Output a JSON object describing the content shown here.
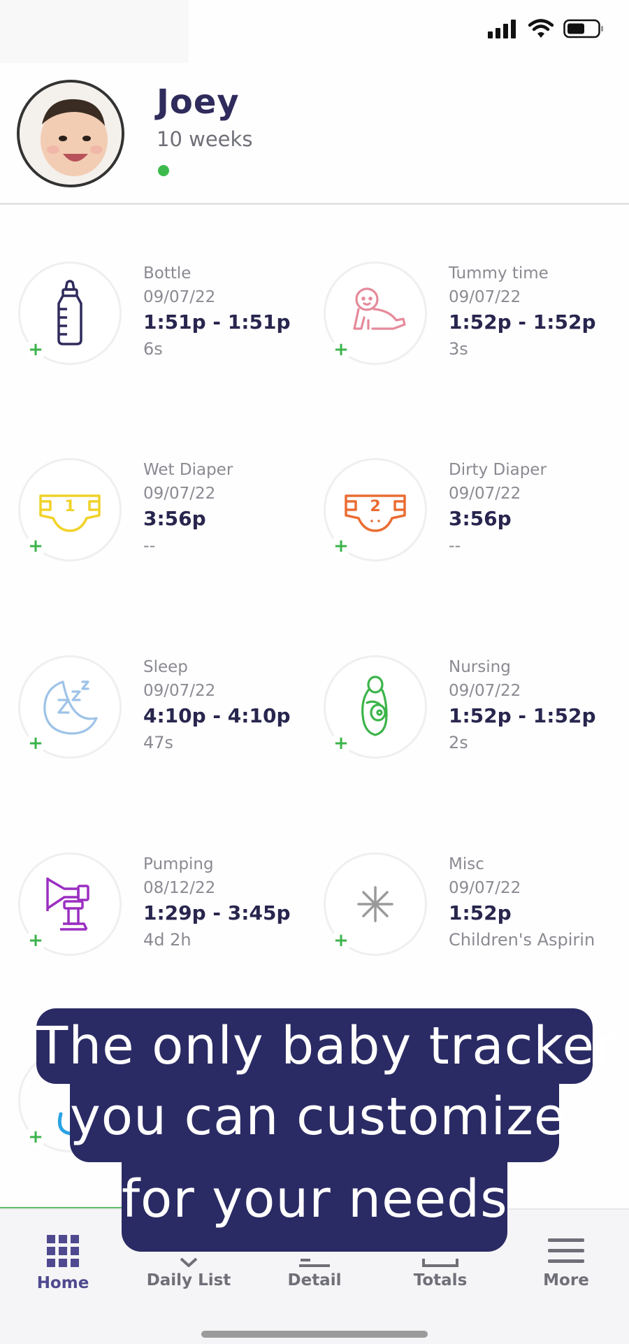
{
  "profile": {
    "name": "Joey",
    "age": "10 weeks",
    "status_color": "#3cbb4c"
  },
  "tiles": [
    {
      "name": "Bottle",
      "date": "09/07/22",
      "time": "1:51p - 1:51p",
      "extra": "6s",
      "icon": "bottle-icon",
      "color": "#2f2b5c"
    },
    {
      "name": "Tummy time",
      "date": "09/07/22",
      "time": "1:52p - 1:52p",
      "extra": "3s",
      "icon": "baby-crawling-icon",
      "color": "#e58a9a"
    },
    {
      "name": "Wet Diaper",
      "date": "09/07/22",
      "time": "3:56p",
      "extra": "--",
      "icon": "diaper-1-icon",
      "color": "#f1d22a"
    },
    {
      "name": "Dirty Diaper",
      "date": "09/07/22",
      "time": "3:56p",
      "extra": "--",
      "icon": "diaper-2-icon",
      "color": "#ea6d33"
    },
    {
      "name": "Sleep",
      "date": "09/07/22",
      "time": "4:10p - 4:10p",
      "extra": "47s",
      "icon": "moon-zzz-icon",
      "color": "#9ec3e8"
    },
    {
      "name": "Nursing",
      "date": "09/07/22",
      "time": "1:52p - 1:52p",
      "extra": "2s",
      "icon": "nursing-icon",
      "color": "#3cb44a"
    },
    {
      "name": "Pumping",
      "date": "08/12/22",
      "time": "1:29p - 3:45p",
      "extra": "4d 2h",
      "icon": "breast-pump-icon",
      "color": "#9b2fc1"
    },
    {
      "name": "Misc",
      "date": "09/07/22",
      "time": "1:52p",
      "extra": "Children's Aspirin",
      "icon": "asterisk-icon",
      "color": "#9a9a9a"
    }
  ],
  "add_label": "+",
  "banner": {
    "line1": "The only baby tracker",
    "line2": "you can customize",
    "line3": "for your needs",
    "color": "#2a2a64"
  },
  "nav": {
    "items": [
      {
        "label": "Home",
        "icon": "grid-icon"
      },
      {
        "label": "Daily List",
        "icon": "list-icon"
      },
      {
        "label": "Detail",
        "icon": "detail-icon"
      },
      {
        "label": "Totals",
        "icon": "totals-icon"
      },
      {
        "label": "More",
        "icon": "menu-icon"
      }
    ],
    "active": "Home"
  }
}
